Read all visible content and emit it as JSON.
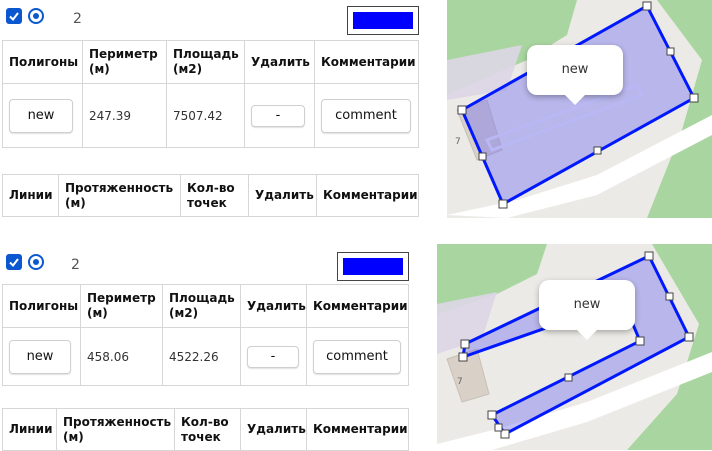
{
  "colors": {
    "polygon_color": "#0000ff",
    "checkbox": "#0b57d0",
    "map_green": "#a9d6a0",
    "map_bg": "#eceae6"
  },
  "panels": [
    {
      "count": "2",
      "polygons_table": {
        "headers": [
          "Полигоны",
          "Периметр (м)",
          "Площадь (м2)",
          "Удалить",
          "Комментарии"
        ],
        "row": {
          "name": "new",
          "perimeter": "247.39",
          "area": "7507.42",
          "delete": "-",
          "comment": "comment"
        }
      },
      "lines_table": {
        "headers": [
          "Линии",
          "Протяженность (м)",
          "Кол-во точек",
          "Удалить",
          "Комментарии"
        ]
      },
      "map": {
        "popup": "new",
        "label": "7"
      }
    },
    {
      "count": "2",
      "polygons_table": {
        "headers": [
          "Полигоны",
          "Периметр (м)",
          "Площадь (м2)",
          "Удалить",
          "Комментарии"
        ],
        "row": {
          "name": "new",
          "perimeter": "458.06",
          "area": "4522.26",
          "delete": "-",
          "comment": "comment"
        }
      },
      "lines_table": {
        "headers": [
          "Линии",
          "Протяженность (м)",
          "Кол-во точек",
          "Удалить",
          "Комментарии"
        ]
      },
      "map": {
        "popup": "new",
        "label": "7"
      }
    }
  ]
}
